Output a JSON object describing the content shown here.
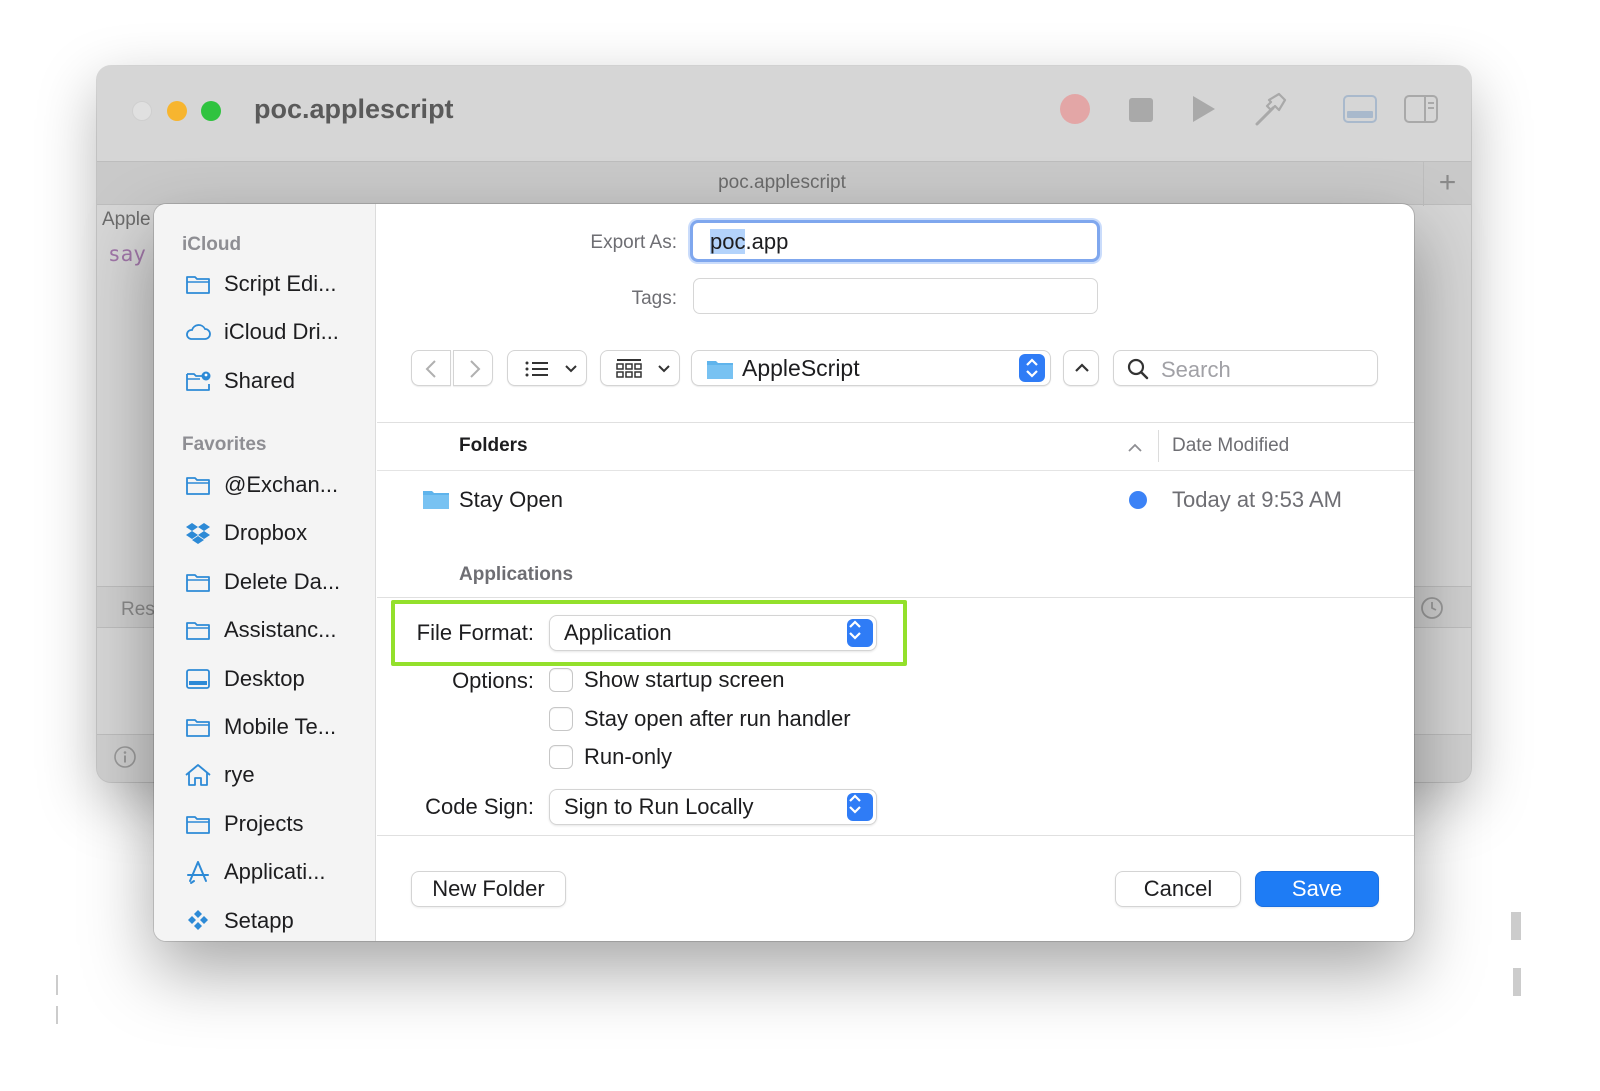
{
  "window": {
    "title": "poc.applescript",
    "tab_title": "poc.applescript",
    "side_label": "Apple",
    "code": "say",
    "result_label": "Res"
  },
  "sidebar": {
    "sections": [
      {
        "title": "iCloud",
        "items": [
          {
            "label": "Script Edi...",
            "icon": "folder-icon"
          },
          {
            "label": "iCloud Dri...",
            "icon": "cloud-icon"
          },
          {
            "label": "Shared",
            "icon": "shared-folder-icon"
          }
        ]
      },
      {
        "title": "Favorites",
        "items": [
          {
            "label": "@Exchan...",
            "icon": "folder-icon"
          },
          {
            "label": "Dropbox",
            "icon": "dropbox-icon"
          },
          {
            "label": "Delete Da...",
            "icon": "folder-icon"
          },
          {
            "label": "Assistanc...",
            "icon": "folder-icon"
          },
          {
            "label": "Desktop",
            "icon": "desktop-icon"
          },
          {
            "label": "Mobile Te...",
            "icon": "folder-icon"
          },
          {
            "label": "rye",
            "icon": "home-icon"
          },
          {
            "label": "Projects",
            "icon": "folder-icon"
          },
          {
            "label": "Applicati...",
            "icon": "applications-icon"
          },
          {
            "label": "Setapp",
            "icon": "setapp-icon"
          }
        ]
      }
    ]
  },
  "dialog": {
    "export_as_label": "Export As:",
    "export_as_selected": "poc",
    "export_as_rest": ".app",
    "tags_label": "Tags:",
    "tags_value": "",
    "location": "AppleScript",
    "search_placeholder": "Search",
    "columns": {
      "name": "Folders",
      "date": "Date Modified"
    },
    "rows": [
      {
        "name": "Stay Open",
        "date": "Today at 9:53 AM",
        "tag_color": "#3b82f6"
      }
    ],
    "group_label": "Applications",
    "file_format_label": "File Format:",
    "file_format_value": "Application",
    "options_label": "Options:",
    "options": [
      {
        "label": "Show startup screen",
        "checked": false
      },
      {
        "label": "Stay open after run handler",
        "checked": false
      },
      {
        "label": "Run-only",
        "checked": false
      }
    ],
    "code_sign_label": "Code Sign:",
    "code_sign_value": "Sign to Run Locally",
    "buttons": {
      "new_folder": "New Folder",
      "cancel": "Cancel",
      "save": "Save"
    }
  },
  "colors": {
    "accent": "#1e7cf5",
    "highlight_box": "#93e02b",
    "tag_blue": "#3b82f6"
  }
}
